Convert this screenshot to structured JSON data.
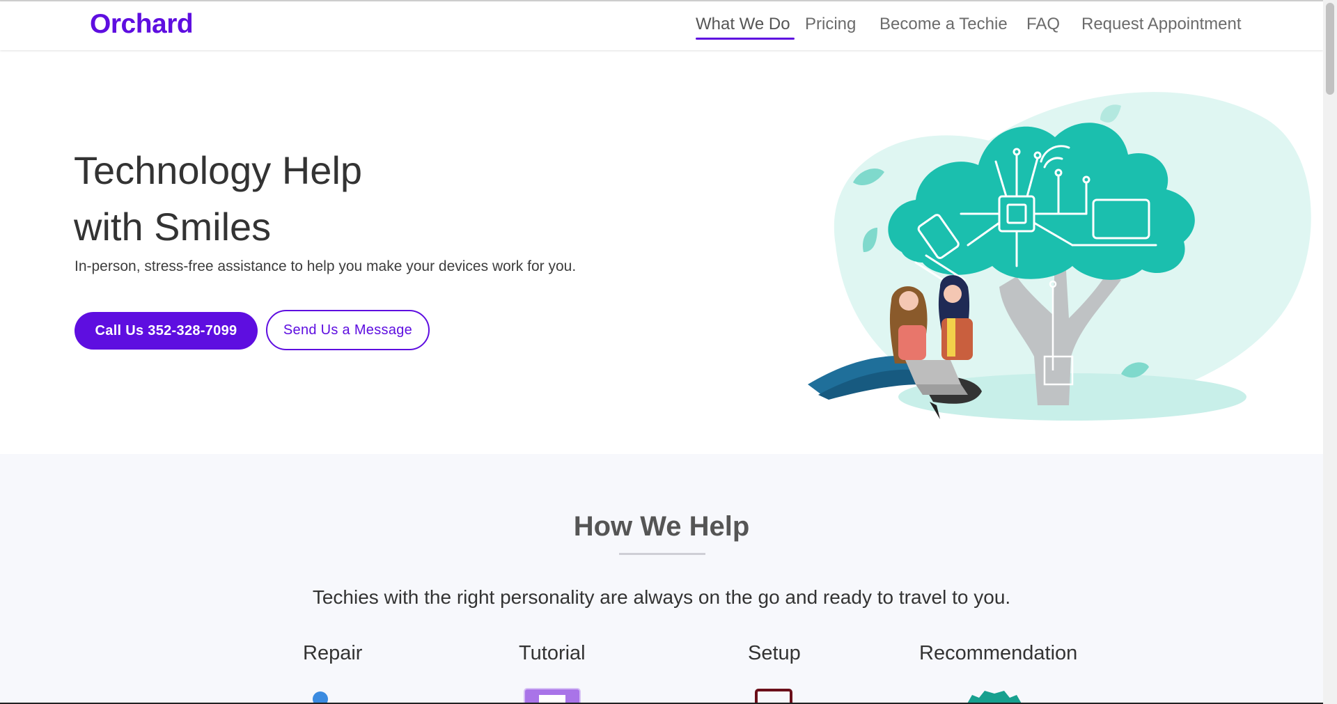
{
  "brand": {
    "name": "Orchard",
    "color": "#5e0ee0"
  },
  "nav": {
    "items": [
      {
        "label": "What We Do",
        "active": true
      },
      {
        "label": "Pricing",
        "active": false
      },
      {
        "label": "Become a Techie",
        "active": false
      },
      {
        "label": "FAQ",
        "active": false
      },
      {
        "label": "Request Appointment",
        "active": false
      }
    ]
  },
  "hero": {
    "title_line1": "Technology Help",
    "title_line2": "with Smiles",
    "subtitle": "In-person, stress-free assistance to help you make your devices work for you.",
    "primary_button": "Call Us 352-328-7099",
    "secondary_button": "Send Us a Message",
    "illustration": "tree-with-people-illustration"
  },
  "help": {
    "title": "How We Help",
    "subtitle": "Techies with the right personality are always on the go and ready to travel to you.",
    "services": [
      {
        "label": "Repair",
        "icon": "repair-icon"
      },
      {
        "label": "Tutorial",
        "icon": "tutorial-icon"
      },
      {
        "label": "Setup",
        "icon": "setup-icon"
      },
      {
        "label": "Recommendation",
        "icon": "recommendation-icon"
      }
    ]
  },
  "colors": {
    "accent": "#5e0ee0",
    "teal": "#1bbfae",
    "section_bg": "#f7f8fc"
  }
}
